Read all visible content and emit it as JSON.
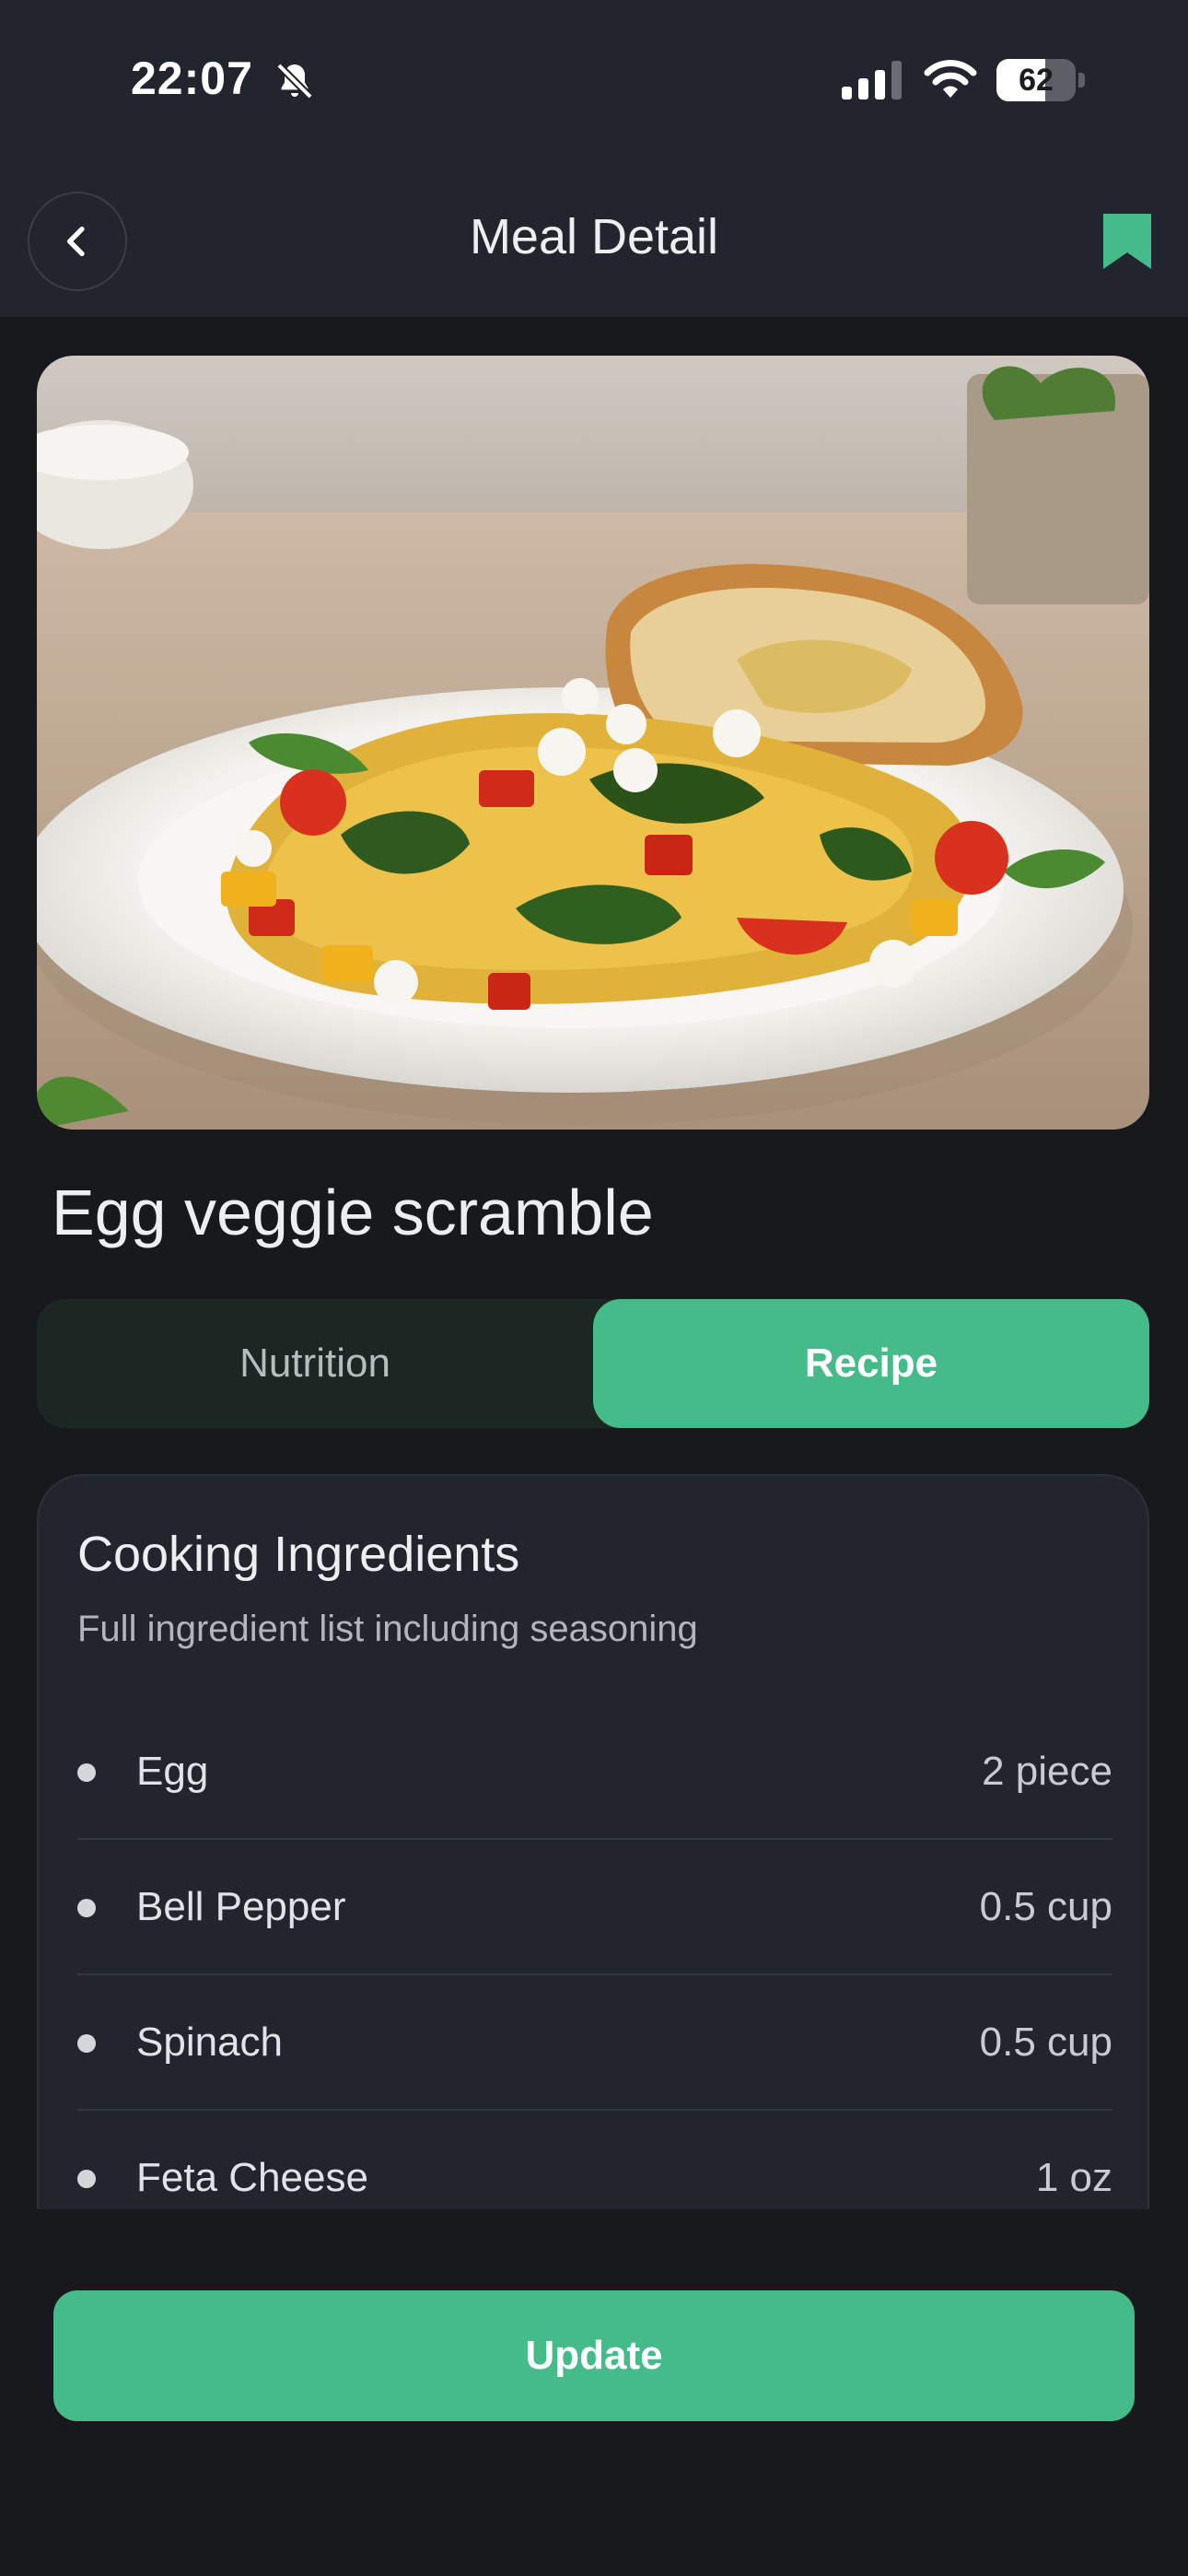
{
  "status_bar": {
    "time": "22:07",
    "battery_level": "62",
    "battery_fraction": 0.62,
    "icons": [
      "bell-slash-icon",
      "cellular-signal-icon",
      "wifi-icon",
      "battery-icon"
    ]
  },
  "header": {
    "title": "Meal Detail",
    "back_icon": "chevron-left-icon",
    "bookmark_icon": "bookmark-icon",
    "bookmark_color": "#45bb8a"
  },
  "meal": {
    "name": "Egg veggie scramble"
  },
  "tabs": [
    {
      "label": "Nutrition",
      "selected": false
    },
    {
      "label": "Recipe",
      "selected": true
    }
  ],
  "ingredients_card": {
    "title": "Cooking Ingredients",
    "subtitle": "Full ingredient list including seasoning",
    "items": [
      {
        "name": "Egg",
        "amount": "2 piece"
      },
      {
        "name": "Bell Pepper",
        "amount": "0.5 cup"
      },
      {
        "name": "Spinach",
        "amount": "0.5 cup"
      },
      {
        "name": "Feta Cheese",
        "amount": "1 oz"
      }
    ]
  },
  "actions": {
    "update_label": "Update"
  },
  "colors": {
    "accent": "#45bb8a",
    "background": "#17191d",
    "surface": "#22252d"
  }
}
